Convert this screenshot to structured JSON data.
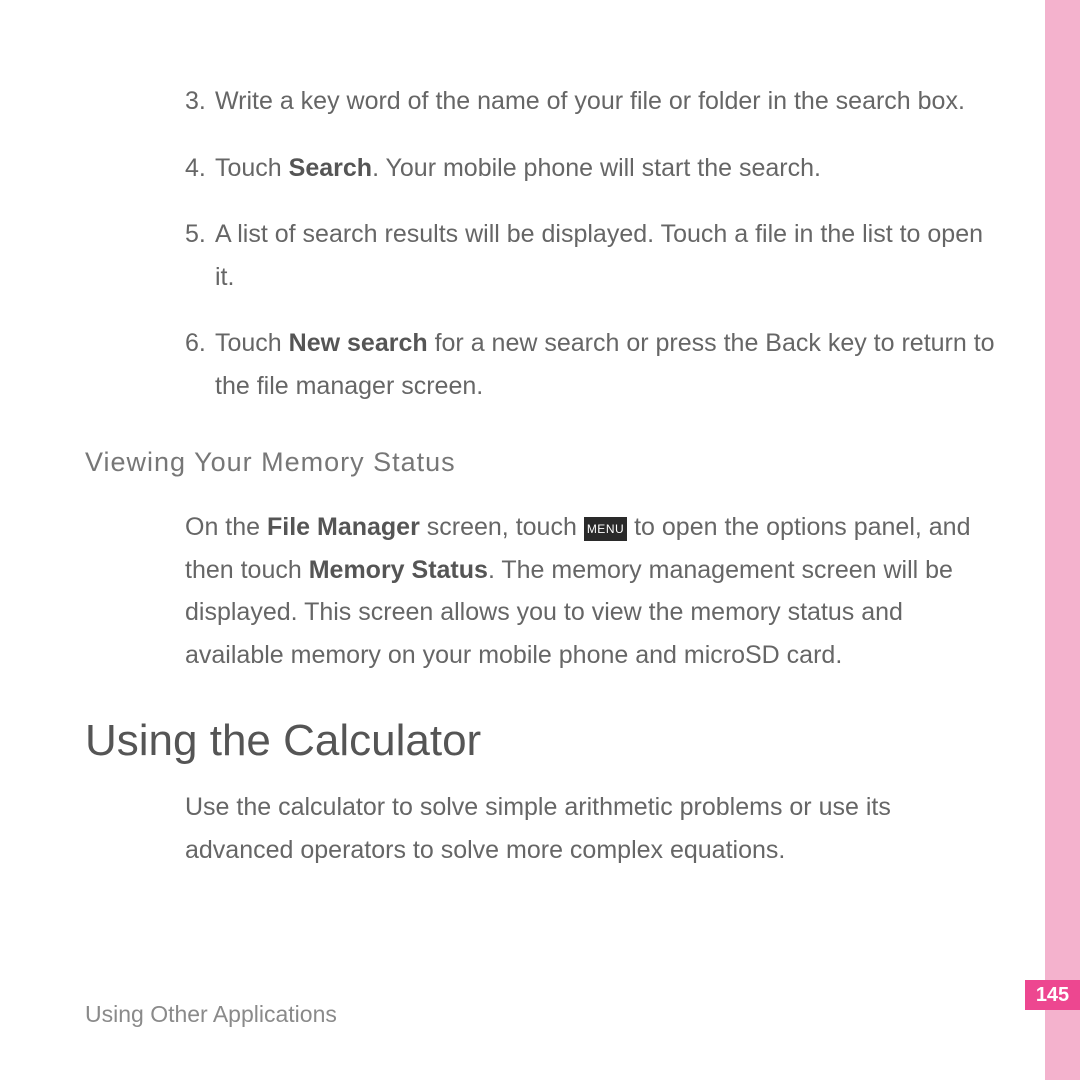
{
  "steps": {
    "s3": "Write a key word of the name of your file or folder in the search box.",
    "s4_pre": "Touch ",
    "s4_b": "Search",
    "s4_post": ". Your mobile phone will start the search.",
    "s5": "A list of search results will be displayed. Touch a file in the list to open it.",
    "s6_pre": "Touch ",
    "s6_b": "New search",
    "s6_post": " for a new search or press the Back key to return to the file manager screen."
  },
  "memory": {
    "heading": "Viewing Your Memory Status",
    "p_pre": "On the ",
    "p_b1": "File Manager",
    "p_mid1": " screen, touch ",
    "icon_label": "MENU",
    "p_mid2": " to open the options panel, and then touch ",
    "p_b2": "Memory Status",
    "p_post": ". The memory management screen will be displayed. This screen allows you to view the memory status and available memory on your mobile phone and microSD card."
  },
  "calculator": {
    "heading": "Using the Calculator",
    "p": "Use the calculator to solve simple arithmetic problems or use its advanced operators to solve more complex equations."
  },
  "footer": "Using Other Applications",
  "page_number": "145"
}
